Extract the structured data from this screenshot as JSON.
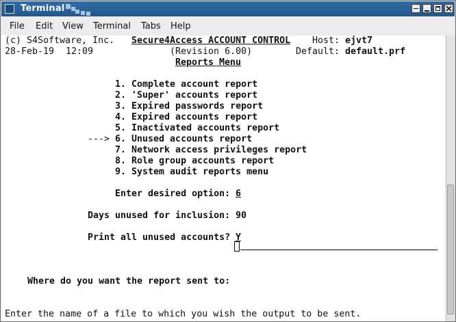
{
  "window": {
    "title": "Terminal"
  },
  "menubar": [
    "File",
    "Edit",
    "View",
    "Terminal",
    "Tabs",
    "Help"
  ],
  "terminal": {
    "line1": {
      "copyright": "(c) S4Software, Inc.",
      "app": "Secure4Access ACCOUNT CONTROL",
      "host_label": "Host:",
      "host_value": "ejvt7"
    },
    "line2": {
      "date": "28-Feb-19",
      "time": "12:09",
      "revision": "(Revision 6.00)",
      "default_label": "Default:",
      "default_value": "default.prf"
    },
    "menu_title": "Reports Menu",
    "options": [
      "1. Complete account report",
      "2. 'Super' accounts report",
      "3. Expired passwords report",
      "4. Expired accounts report",
      "5. Inactivated accounts report",
      "6. Unused accounts report",
      "7. Network access privileges report",
      "8. Role group accounts report",
      "9. System audit reports menu"
    ],
    "selected_arrow": "--->",
    "desired_label": "Enter desired option:",
    "desired_value": "6",
    "days_label": "Days unused for inclusion:",
    "days_value": "90",
    "print_label": "Print all unused accounts?",
    "print_value": "Y",
    "sent_label": "Where do you want the report sent to:",
    "status": "Enter the name of a file to which you wish the output to be sent."
  }
}
